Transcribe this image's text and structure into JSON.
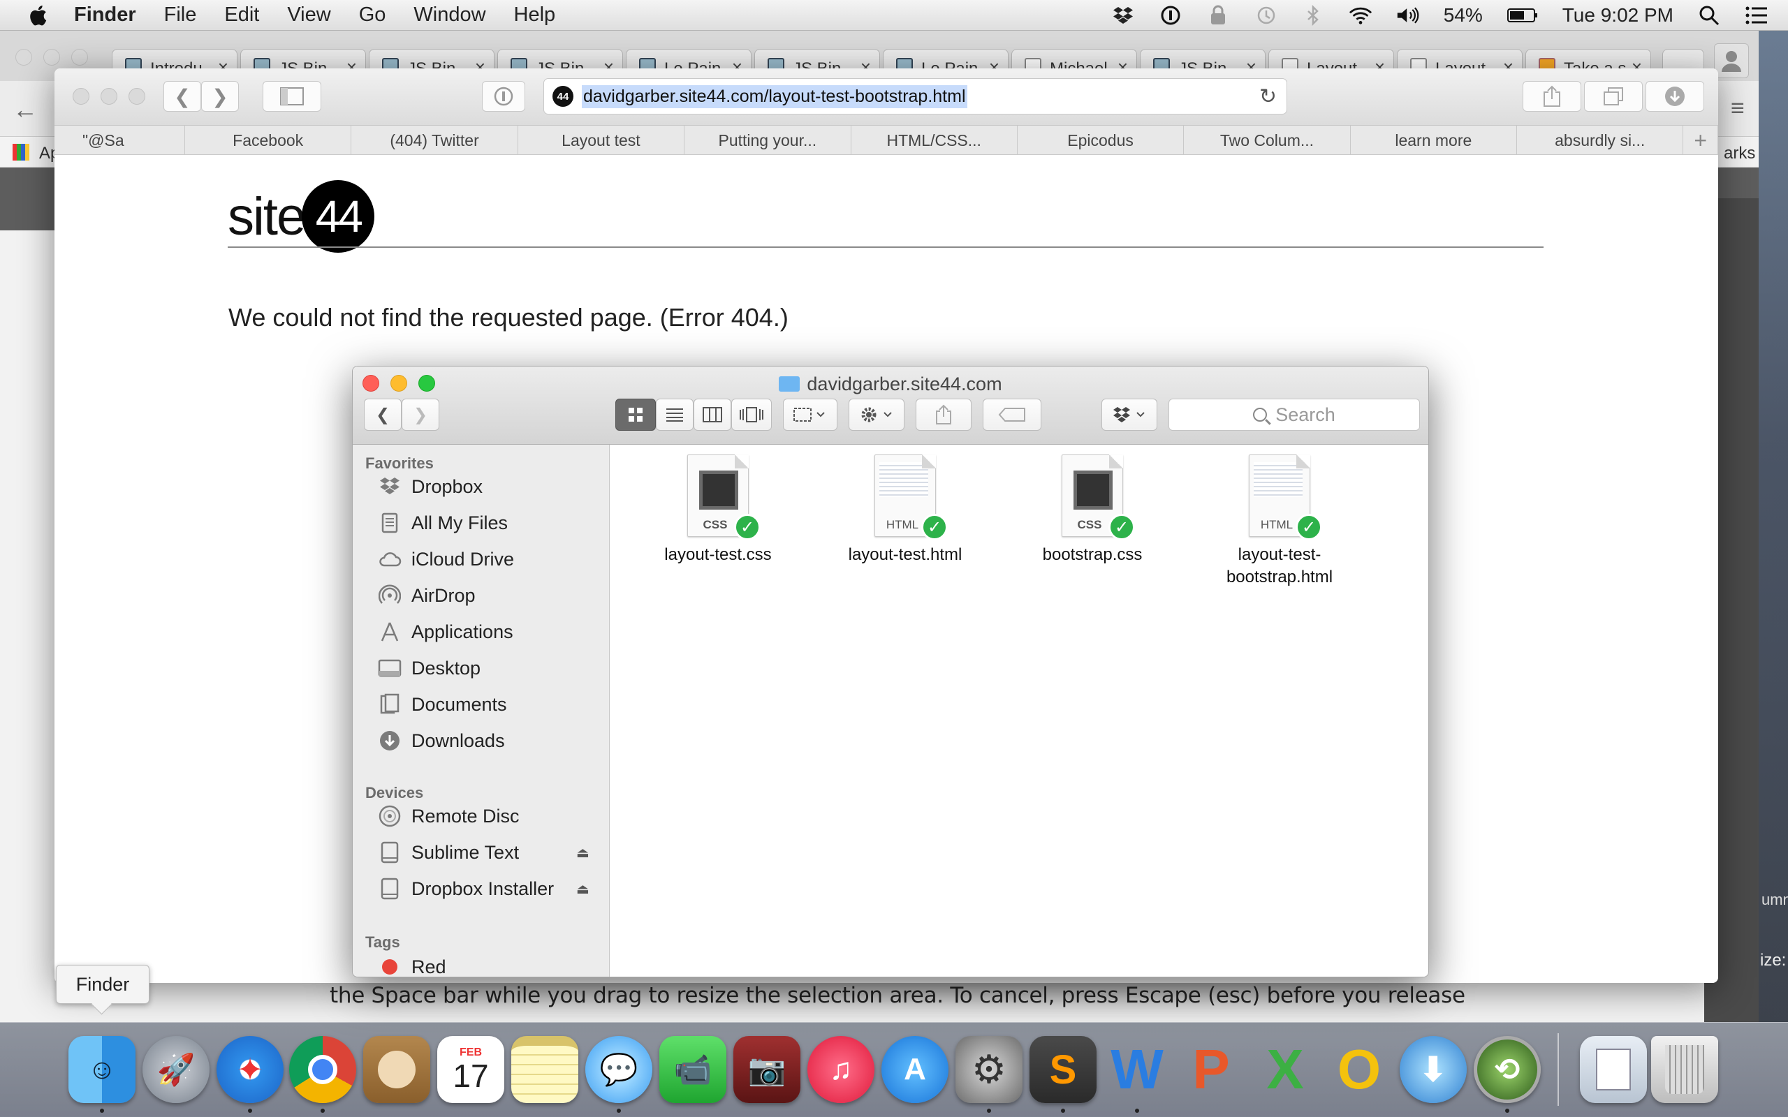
{
  "menubar": {
    "app": "Finder",
    "items": [
      "File",
      "Edit",
      "View",
      "Go",
      "Window",
      "Help"
    ],
    "battery": "54%",
    "clock": "Tue 9:02 PM"
  },
  "chrome": {
    "tabs": [
      "Introdu",
      "JS Bin",
      "JS Bin",
      "JS Bin",
      "Le Pain",
      "JS Bin",
      "Le Pain",
      "Michael",
      "JS Bin",
      "Layout",
      "Layout",
      "Take a s"
    ],
    "apps_stub": "Ap",
    "marks_stub": "arks"
  },
  "safari": {
    "url": "davidgarber.site44.com/layout-test-bootstrap.html",
    "favorites": [
      "\"@Sa",
      "Facebook",
      "(404) Twitter",
      "Layout test",
      "Putting your...",
      "HTML/CSS...",
      "Epicodus",
      "Two Colum...",
      "learn more",
      "absurdly si..."
    ],
    "logo_word": "site",
    "logo_num": "44",
    "error_text": "We could not find the requested page. (Error 404.)",
    "site_icon": "44"
  },
  "finder": {
    "title": "davidgarber.site44.com",
    "search_placeholder": "Search",
    "sidebar": {
      "favorites_header": "Favorites",
      "favorites": [
        {
          "label": "Dropbox",
          "icon": "dropbox-icon"
        },
        {
          "label": "All My Files",
          "icon": "all-files-icon"
        },
        {
          "label": "iCloud Drive",
          "icon": "cloud-icon"
        },
        {
          "label": "AirDrop",
          "icon": "airdrop-icon"
        },
        {
          "label": "Applications",
          "icon": "applications-icon"
        },
        {
          "label": "Desktop",
          "icon": "desktop-icon"
        },
        {
          "label": "Documents",
          "icon": "documents-icon"
        },
        {
          "label": "Downloads",
          "icon": "downloads-icon"
        }
      ],
      "devices_header": "Devices",
      "devices": [
        {
          "label": "Remote Disc",
          "icon": "disc-icon"
        },
        {
          "label": "Sublime Text",
          "icon": "drive-icon"
        },
        {
          "label": "Dropbox Installer",
          "icon": "drive-icon"
        }
      ],
      "tags_header": "Tags",
      "tags": [
        {
          "label": "Red",
          "color": "#e8443a"
        }
      ]
    },
    "files": [
      {
        "name": "layout-test.css",
        "type": "CSS"
      },
      {
        "name": "layout-test.html",
        "type": "HTML"
      },
      {
        "name": "bootstrap.css",
        "type": "CSS"
      },
      {
        "name": "layout-test-bootstrap.html",
        "type": "HTML",
        "name_line1": "layout-test-",
        "name_line2": "bootstrap.html"
      }
    ]
  },
  "tooltip": "Finder",
  "caption": "the Space bar while you drag to resize the selection area. To cancel, press Escape (esc) before you release",
  "edge_text_1": "ize:",
  "edge_text_2": "umn",
  "dock": {
    "calendar_month": "FEB",
    "calendar_day": "17",
    "items": [
      "finder",
      "launchpad",
      "safari",
      "chrome",
      "contacts",
      "calendar",
      "notes",
      "messages",
      "facetime",
      "photo-booth",
      "itunes",
      "app-store",
      "system-preferences",
      "sublime-text",
      "word",
      "powerpoint",
      "excel",
      "outlook",
      "dropbox-installer",
      "time-machine",
      "documents-stack",
      "trash"
    ]
  },
  "colors": {
    "close": "#ff5f57",
    "minimize": "#febc2e",
    "zoom": "#28c840",
    "check": "#2db24a"
  }
}
